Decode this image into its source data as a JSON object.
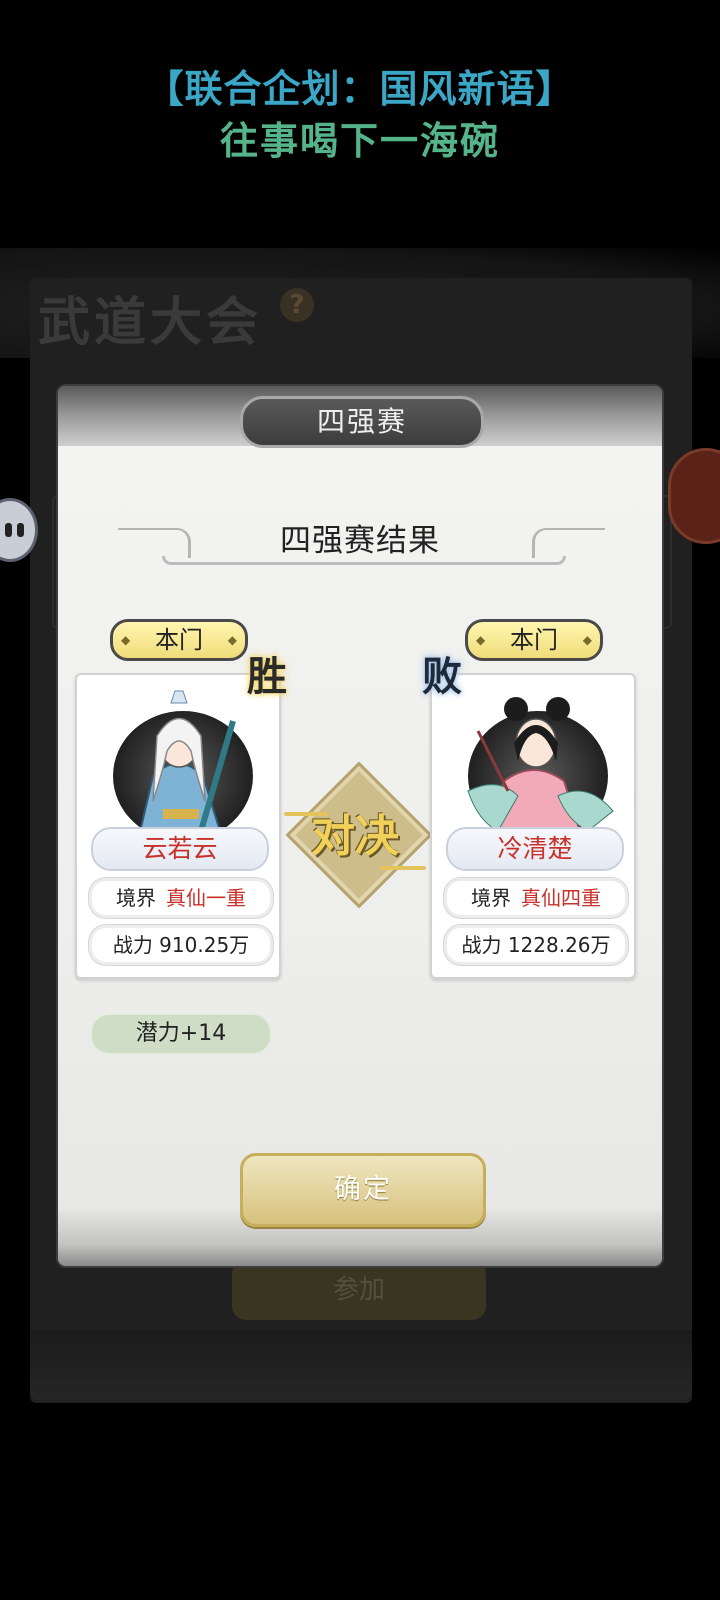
{
  "banner": {
    "line1": "【联合企划：国风新语】",
    "line2": "往事喝下一海碗"
  },
  "background": {
    "title": "武道大会",
    "help_icon": "?",
    "join_label": "参加"
  },
  "modal": {
    "tab_label": "四强赛",
    "result_title": "四强赛结果",
    "versus_label": "对决",
    "confirm_label": "确定"
  },
  "left_fighter": {
    "sect": "本门",
    "outcome": "胜",
    "name": "云若云",
    "realm_label": "境界",
    "realm_value": "真仙一重",
    "power_text": "战力 910.25万",
    "potential_text": "潜力+14"
  },
  "right_fighter": {
    "sect": "本门",
    "outcome": "败",
    "name": "冷清楚",
    "realm_label": "境界",
    "realm_value": "真仙四重",
    "power_text": "战力 1228.26万"
  },
  "colors": {
    "banner_line1": "#3aa7c6",
    "banner_line2": "#55b48a",
    "name_red": "#c8312a",
    "gold": "#f2d15a"
  }
}
